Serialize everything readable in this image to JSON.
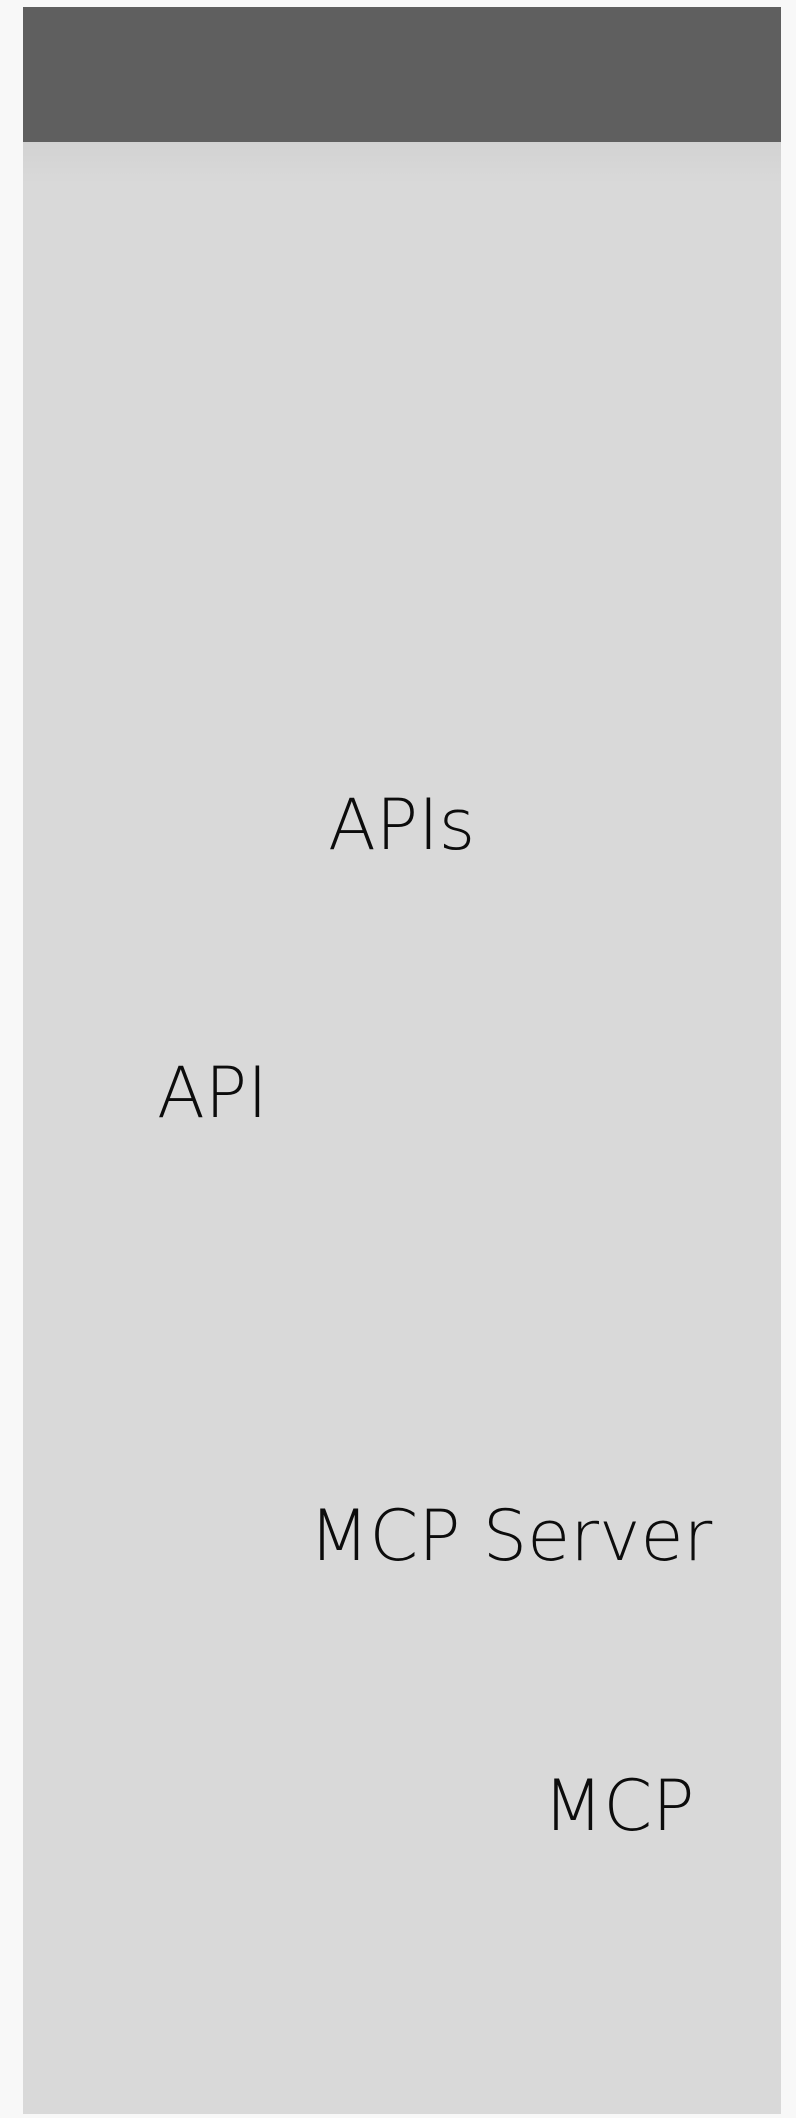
{
  "labels": {
    "apis": "APIs",
    "api": "API",
    "mcp_server": "MCP Server",
    "mcp": "MCP"
  },
  "colors": {
    "page_background": "#f8f8f8",
    "panel_background": "#d9d9d9",
    "header_bar": "#5f5f5f",
    "text": "#0c0c0c"
  }
}
